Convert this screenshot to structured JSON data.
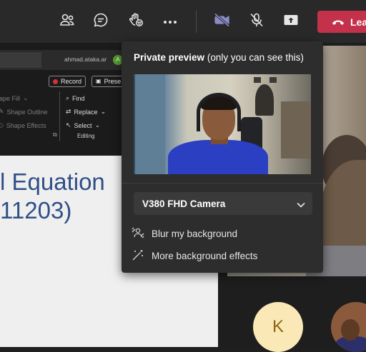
{
  "toolbar": {
    "icons": [
      "people-icon",
      "chat-icon",
      "raise-hand-icon",
      "more-icon",
      "camera-off-icon",
      "mic-off-icon",
      "share-icon"
    ],
    "leave_label": "Lea",
    "leave_color": "#c4314b",
    "camera_color": "#8b8cc7"
  },
  "ppt": {
    "user": "ahmad.ataka.ar",
    "avatar_letter": "A",
    "record_label": "Record",
    "present_label": "Prese",
    "shape_fill": "Shape Fill",
    "shape_outline": "Shape Outline",
    "shape_effects": "Shape Effects",
    "find": "Find",
    "replace": "Replace",
    "select": "Select",
    "group_label": "Editing"
  },
  "slide": {
    "line1": "l Equation",
    "line2": "11203)"
  },
  "popup": {
    "title_bold": "Private preview",
    "title_rest": "(only you can see this)",
    "camera_name": "V380 FHD Camera",
    "blur_label": "Blur my background",
    "effects_label": "More background effects"
  },
  "participants": {
    "k_initial": "K"
  }
}
